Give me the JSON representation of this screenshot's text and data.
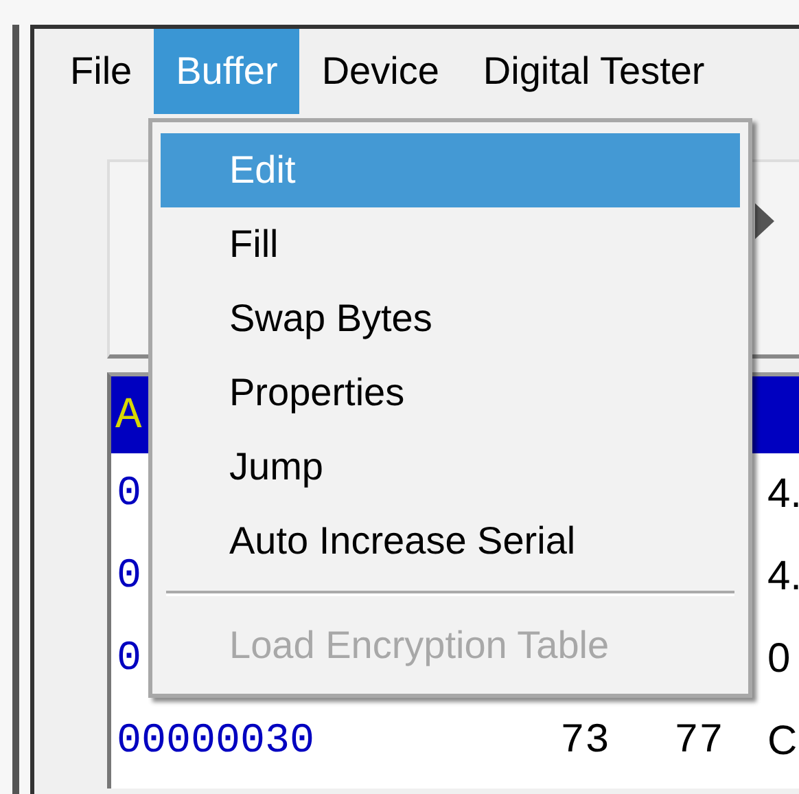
{
  "menu_bar": [
    {
      "label": "File",
      "selected": false
    },
    {
      "label": "Buffer",
      "selected": true
    },
    {
      "label": "Device",
      "selected": false
    },
    {
      "label": "Digital Tester",
      "selected": false
    }
  ],
  "buffer_menu": [
    {
      "kind": "item",
      "label": "Edit",
      "highlighted": true,
      "disabled": false
    },
    {
      "kind": "item",
      "label": "Fill",
      "highlighted": false,
      "disabled": false
    },
    {
      "kind": "item",
      "label": "Swap Bytes",
      "highlighted": false,
      "disabled": false
    },
    {
      "kind": "item",
      "label": "Properties",
      "highlighted": false,
      "disabled": false
    },
    {
      "kind": "item",
      "label": "Jump",
      "highlighted": false,
      "disabled": false
    },
    {
      "kind": "item",
      "label": "Auto Increase Serial",
      "highlighted": false,
      "disabled": false
    },
    {
      "kind": "separator"
    },
    {
      "kind": "item",
      "label": "Load Encryption Table",
      "highlighted": false,
      "disabled": true
    }
  ],
  "hex_table": {
    "header": "A",
    "rows": [
      {
        "address": "0",
        "bytes": [],
        "ascii": "4."
      },
      {
        "address": "0",
        "bytes": [],
        "ascii": "4."
      },
      {
        "address": "0",
        "bytes": [],
        "ascii": "0"
      },
      {
        "address": "00000030",
        "bytes": [
          "73",
          "77"
        ],
        "ascii": "C"
      }
    ]
  }
}
